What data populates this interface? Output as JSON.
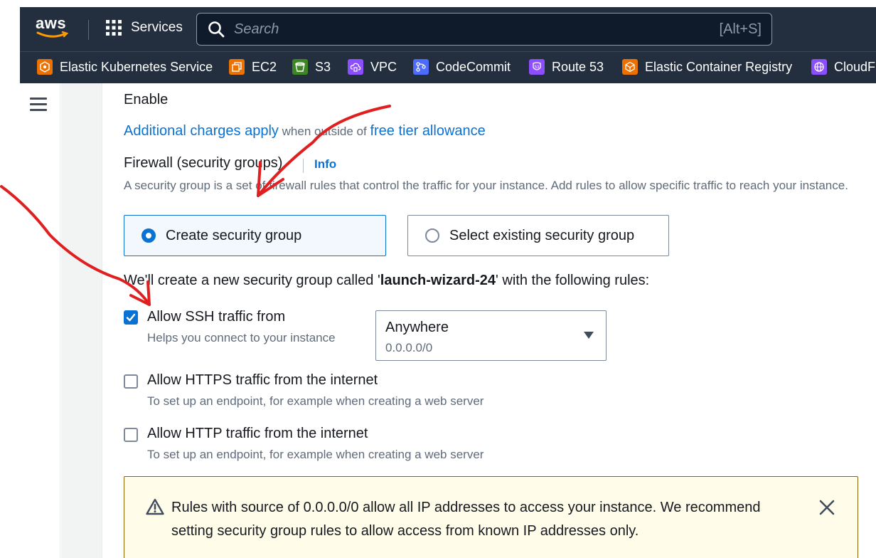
{
  "topnav": {
    "logo_text": "aws",
    "services_label": "Services",
    "search_placeholder": "Search",
    "search_shortcut": "[Alt+S]"
  },
  "favorites": [
    {
      "label": "Elastic Kubernetes Service",
      "icon": "eks-icon",
      "color": "#ed7100"
    },
    {
      "label": "EC2",
      "icon": "ec2-icon",
      "color": "#ed7100"
    },
    {
      "label": "S3",
      "icon": "s3-icon",
      "color": "#3f8624"
    },
    {
      "label": "VPC",
      "icon": "vpc-icon",
      "color": "#8c4fff"
    },
    {
      "label": "CodeCommit",
      "icon": "codecommit-icon",
      "color": "#4d6bfe"
    },
    {
      "label": "Route 53",
      "icon": "route53-icon",
      "color": "#8c4fff"
    },
    {
      "label": "Elastic Container Registry",
      "icon": "ecr-icon",
      "color": "#ed7100"
    },
    {
      "label": "CloudFr",
      "icon": "cloudfront-icon",
      "color": "#8c4fff"
    }
  ],
  "content": {
    "enable_text": "Enable",
    "charges_link": "Additional charges apply",
    "charges_middle": " when outside of ",
    "free_tier_link": "free tier allowance",
    "firewall_label": "Firewall (security groups)",
    "info_link": "Info",
    "firewall_desc": "A security group is a set of firewall rules that control the traffic for your instance. Add rules to allow specific traffic to reach your instance.",
    "create_sg_label": "Create security group",
    "select_sg_label": "Select existing security group",
    "will_create_prefix": "We'll create a new security group called '",
    "sg_name": "launch-wizard-24",
    "will_create_suffix": "' with the following rules:",
    "ssh": {
      "label": "Allow SSH traffic from",
      "desc": "Helps you connect to your instance",
      "checked": true,
      "source_value": "Anywhere",
      "source_cidr": "0.0.0.0/0"
    },
    "https": {
      "label": "Allow HTTPS traffic from the internet",
      "desc": "To set up an endpoint, for example when creating a web server",
      "checked": false
    },
    "http": {
      "label": "Allow HTTP traffic from the internet",
      "desc": "To set up an endpoint, for example when creating a web server",
      "checked": false
    },
    "alert_text": "Rules with source of 0.0.0.0/0 allow all IP addresses to access your instance. We recommend setting security group rules to allow access from known IP addresses only."
  },
  "colors": {
    "nav_bg": "#232f3e",
    "link": "#0972d3",
    "annotation": "#e02020",
    "warning_bg": "#fffce9"
  }
}
